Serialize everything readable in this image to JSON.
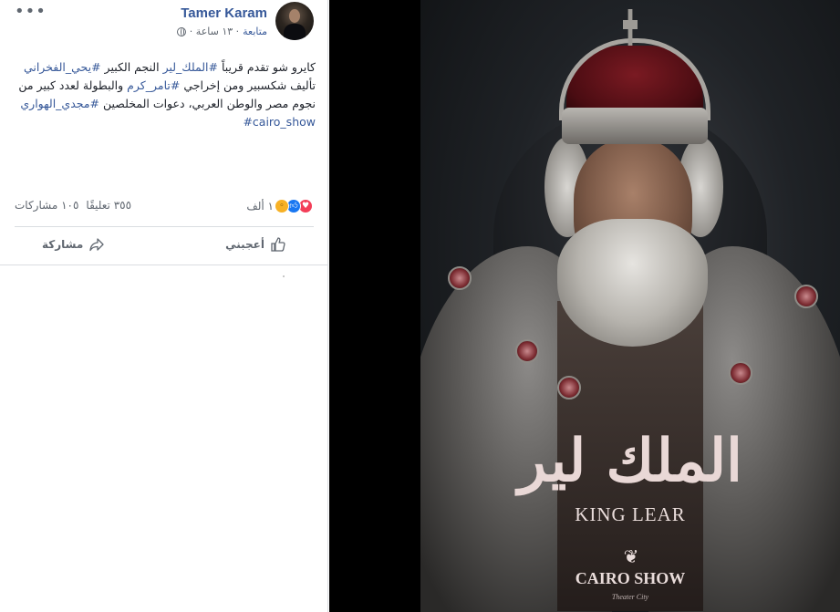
{
  "post": {
    "more_label": "•••",
    "author": "Tamer Karam",
    "follow_label": "متابعة",
    "time": "· ١٣ ساعة ·",
    "text": {
      "line1_prefix": "كايرو شو تقدم قريباً ",
      "tag1": "#الملك_لير",
      "line1_mid": " النجم الكبير ",
      "tag2": "#يحي_الفخراني",
      "line1_suffix": " تأليف شكسبير ومن إخراجي ",
      "tag3": "#تامر_كرم",
      "line2": " والبطولة لعدد كبير من نجوم مصر والوطن العربي، دعوات المخلصين ",
      "tag4": "#مجدي_الهواري",
      "tag5": "#cairo_show"
    },
    "reactions": {
      "count": "١ ألف",
      "icons": [
        "love-icon",
        "like-icon",
        "wow-icon"
      ]
    },
    "comments": "٣٥٥ تعليقًا",
    "shares": "١٠٥ مشاركات",
    "actions": {
      "like": "أعجبني",
      "share": "مشاركة"
    }
  },
  "photo": {
    "title_ar": "الملك لير",
    "title_en": "KING LEAR",
    "brand": "CAIRO SHOW",
    "brand_sub": "Theater City"
  },
  "colors": {
    "link": "#365899",
    "muted": "#606770",
    "love": "#f33e58",
    "like": "#1877f2",
    "wow": "#f7b125"
  }
}
